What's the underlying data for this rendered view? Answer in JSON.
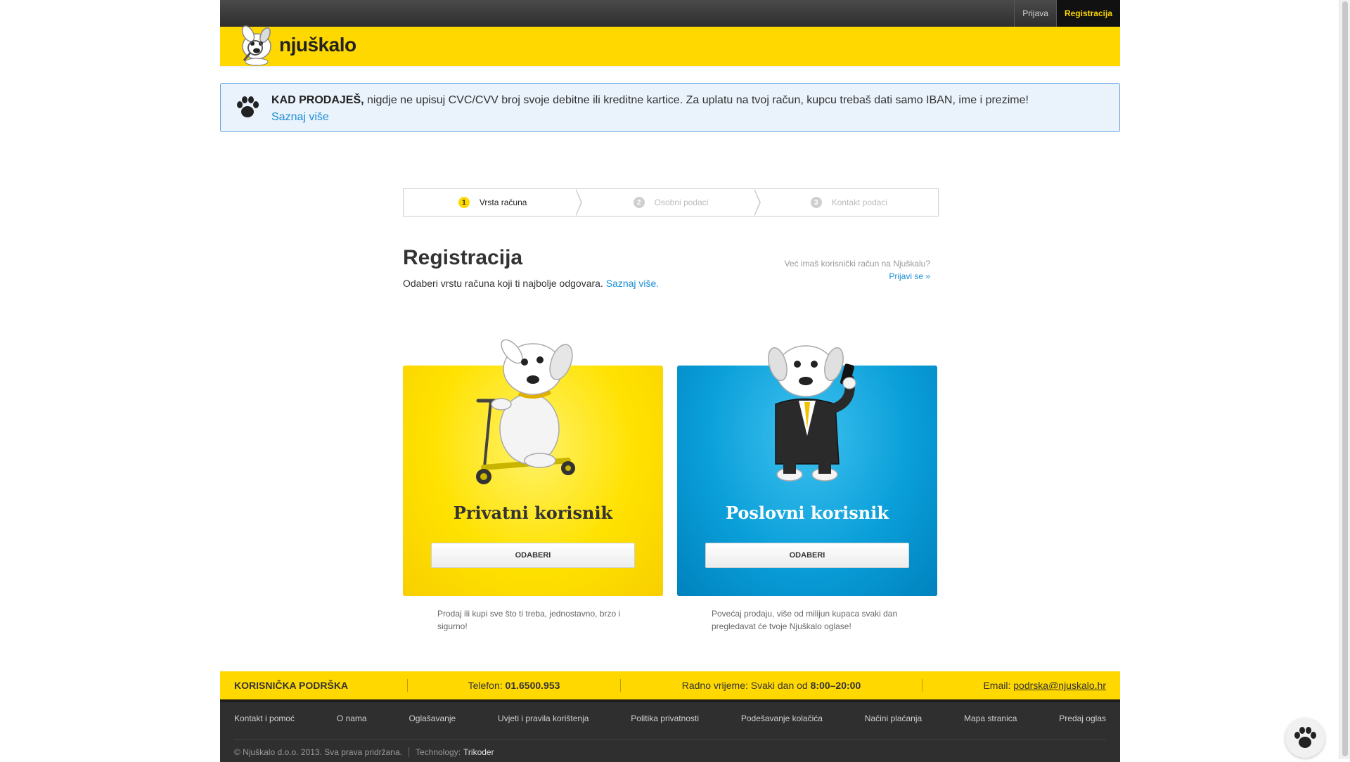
{
  "header": {
    "brand": "njuškalo",
    "login_link": "Prijava",
    "register_link": "Registracija"
  },
  "notice": {
    "bold": "KAD PRODAJEŠ,",
    "text": " nigdje ne upisuj CVC/CVV broj svoje debitne ili kreditne kartice. Za uplatu na tvoj račun, kupcu trebaš dati samo IBAN, ime i prezime!",
    "link": "Saznaj više"
  },
  "steps": [
    {
      "num": "1",
      "label": "Vrsta računa",
      "active": true
    },
    {
      "num": "2",
      "label": "Osobni podaci",
      "active": false
    },
    {
      "num": "3",
      "label": "Kontakt podaci",
      "active": false
    }
  ],
  "page": {
    "title": "Registracija",
    "subtitle": "Odaberi vrstu računa koji ti najbolje odgovara.",
    "subtitle_link": "Saznaj više.",
    "login_hint": "Već imaš korisnički račun na Njuškalu?",
    "login_hint_link": "Prijavi se »"
  },
  "cards": {
    "private": {
      "title": "Privatni korisnik",
      "button": "ODABERI",
      "description": "Prodaj ili kupi sve što ti treba, jednostavno, brzo i sigurno!"
    },
    "business": {
      "title": "Poslovni korisnik",
      "button": "ODABERI",
      "description": "Povećaj prodaju, više od milijun kupaca svaki dan pregledavat će tvoje Njuškalo oglase!"
    }
  },
  "support": {
    "title": "KORISNIČKA PODRŠKA",
    "phone_label": "Telefon: ",
    "phone": "01.6500.953",
    "hours_label": "Radno vrijeme: Svaki dan od ",
    "hours": "8:00–20:00",
    "email_label": "Email: ",
    "email": "podrska@njuskalo.hr"
  },
  "footer": {
    "links": [
      "Kontakt i pomoć",
      "O nama",
      "Oglašavanje",
      "Uvjeti i pravila korištenja",
      "Politika privatnosti",
      "Podešavanje kolačića",
      "Načini plaćanja",
      "Mapa stranica",
      "Predaj oglas"
    ],
    "copyright": "© Njuškalo d.o.o. 2013. Sva prava pridržana.",
    "tech_label": "Technology:",
    "tech_name": "Trikoder"
  },
  "colors": {
    "brand_yellow": "#ffd800",
    "brand_blue": "#0a9fd9",
    "link_blue": "#1a8fd6",
    "dark": "#2f2f2f"
  },
  "icons": {
    "notice": "paw-icon",
    "fab": "paw-icon",
    "logo": "dog-mascot-icon"
  }
}
